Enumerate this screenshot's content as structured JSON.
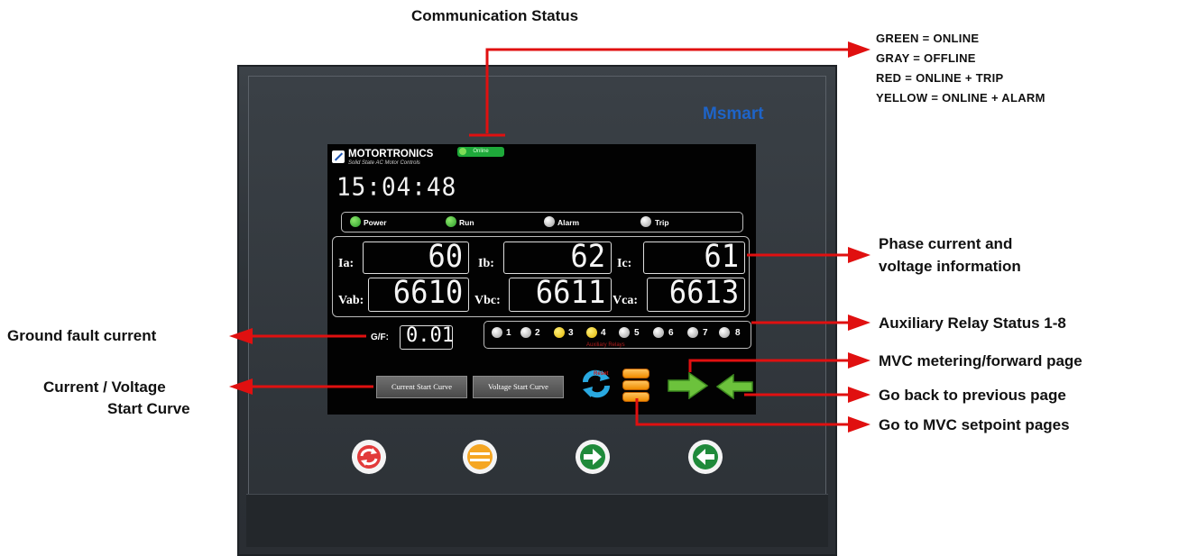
{
  "callouts": {
    "communication_status": "Communication Status",
    "legend": [
      "GREEN = ONLINE",
      "GRAY = OFFLINE",
      "RED = ONLINE + TRIP",
      "YELLOW = ONLINE + ALARM"
    ],
    "phase_line1": "Phase current and",
    "phase_line2": "voltage information",
    "aux_relay": "Auxiliary Relay Status 1-8",
    "mvc_forward": "MVC metering/forward page",
    "go_back": "Go back to previous page",
    "setpoint": "Go to MVC setpoint pages",
    "ground_fault": "Ground fault current",
    "start_curve_line1": "Current / Voltage",
    "start_curve_line2": "Start Curve"
  },
  "device": {
    "brand": "Msmart",
    "company": "MOTORTRONICS",
    "tagline": "Solid State AC Motor Controls",
    "comm_status": "Online",
    "clock": "15:04:48",
    "indicators": [
      {
        "label": "Power",
        "state": "green"
      },
      {
        "label": "Run",
        "state": "green"
      },
      {
        "label": "Alarm",
        "state": "gray"
      },
      {
        "label": "Trip",
        "state": "gray"
      }
    ],
    "currents": [
      {
        "label": "Ia:",
        "value": "60"
      },
      {
        "label": "Ib:",
        "value": "62"
      },
      {
        "label": "Ic:",
        "value": "61"
      }
    ],
    "voltages": [
      {
        "label": "Vab:",
        "value": "6610"
      },
      {
        "label": "Vbc:",
        "value": "6611"
      },
      {
        "label": "Vca:",
        "value": "6613"
      }
    ],
    "ground_fault": {
      "label": "G/F:",
      "value": "0.01"
    },
    "relays": [
      {
        "num": "1",
        "state": "gray"
      },
      {
        "num": "2",
        "state": "gray"
      },
      {
        "num": "3",
        "state": "yellow"
      },
      {
        "num": "4",
        "state": "yellow"
      },
      {
        "num": "5",
        "state": "gray"
      },
      {
        "num": "6",
        "state": "gray"
      },
      {
        "num": "7",
        "state": "gray"
      },
      {
        "num": "8",
        "state": "gray"
      }
    ],
    "relay_caption": "Auxiliary Relays",
    "buttons": {
      "current_curve": "Current Start Curve",
      "voltage_curve": "Voltage Start Curve",
      "reset_label": "Reset"
    }
  },
  "colors": {
    "arrow": "#e01010",
    "green": "#2a9b2a",
    "orange": "#f08c00",
    "brand_blue": "#1e64c8"
  }
}
